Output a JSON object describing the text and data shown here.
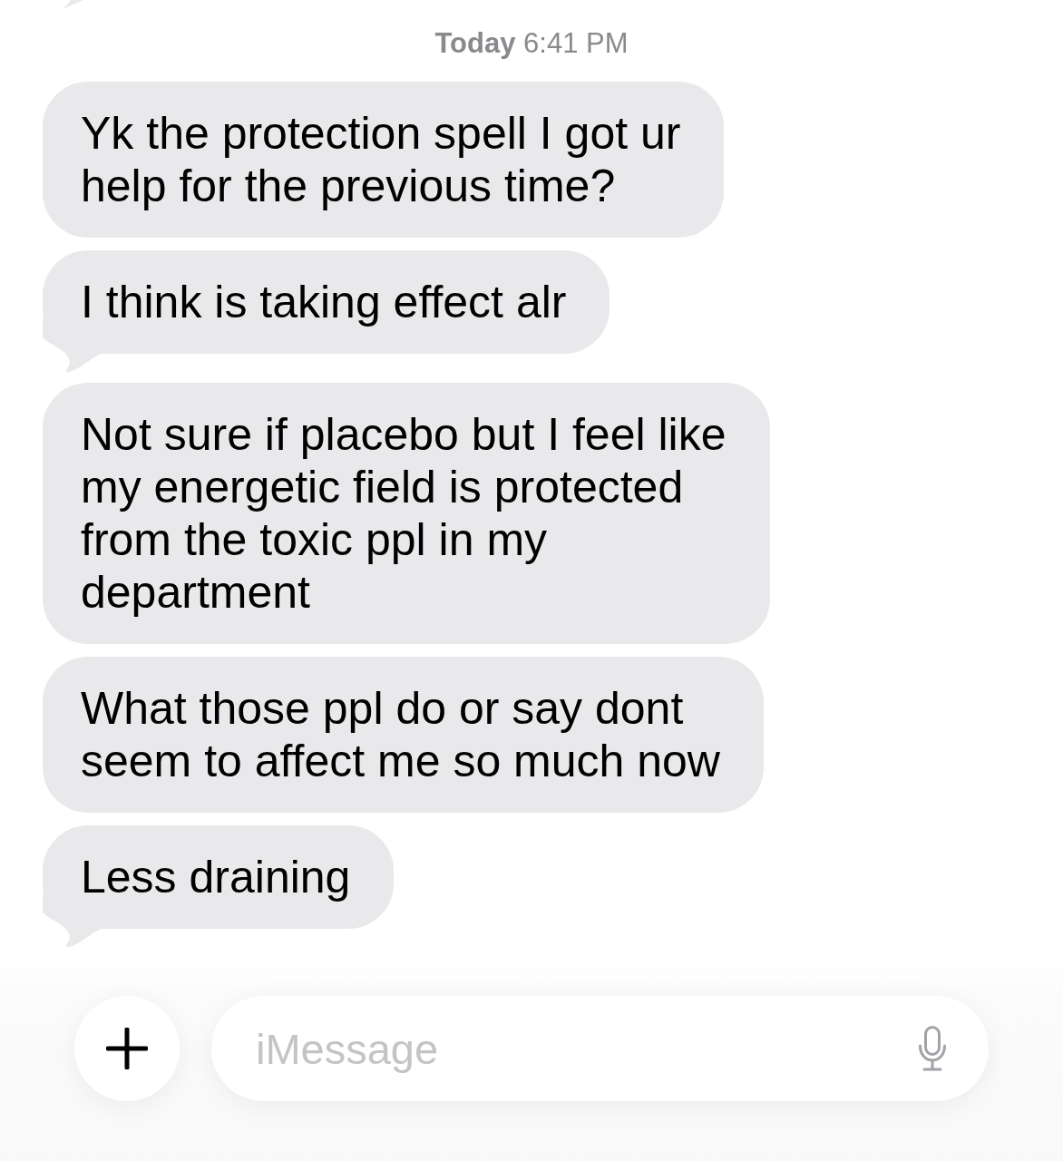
{
  "timestamp": "**Today** 6:41 PM",
  "messages": [
    {
      "lines": [
        "Yk the protection spell I got ur",
        "help for the previous time?"
      ],
      "tail": false
    },
    {
      "lines": [
        "I think is taking effect alr"
      ],
      "tail": true
    },
    {
      "lines": [
        "Not sure if placebo but I feel like",
        "my energetic field is protected",
        "from the toxic ppl in my",
        "department"
      ],
      "tail": false
    },
    {
      "lines": [
        "What those ppl do or say dont",
        "seem to affect me so much now"
      ],
      "tail": false
    },
    {
      "lines": [
        "Less draining"
      ],
      "tail": true
    }
  ],
  "composer": {
    "placeholder": "iMessage"
  }
}
